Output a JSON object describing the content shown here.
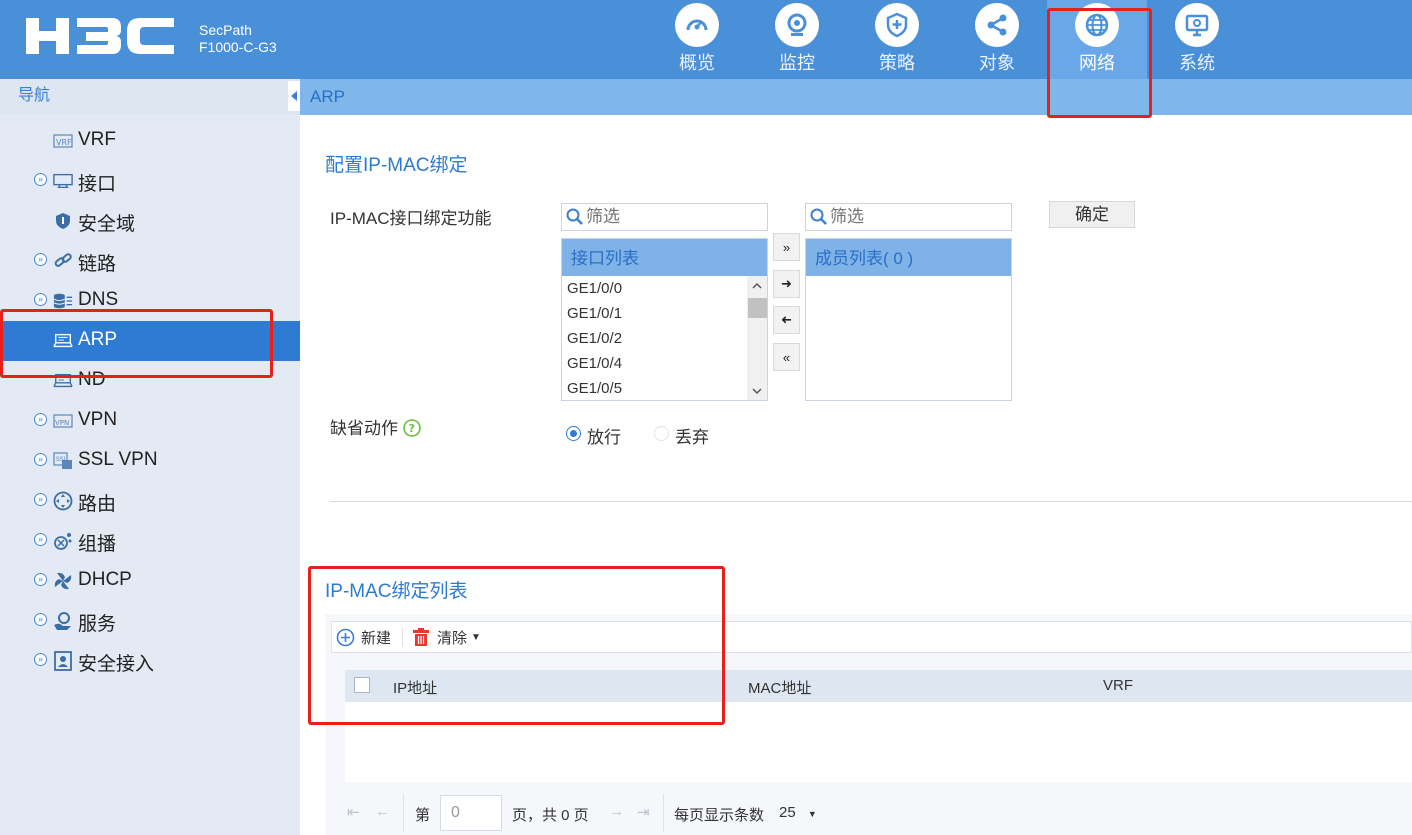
{
  "header": {
    "brand": "H3C",
    "model_line1": "SecPath",
    "model_line2": "F1000-C-G3",
    "nav": [
      {
        "label": "概览",
        "icon": "speedometer-icon"
      },
      {
        "label": "监控",
        "icon": "camera-icon"
      },
      {
        "label": "策略",
        "icon": "shield-icon"
      },
      {
        "label": "对象",
        "icon": "share-icon"
      },
      {
        "label": "网络",
        "icon": "globe-icon",
        "active": true
      },
      {
        "label": "系统",
        "icon": "monitor-icon"
      }
    ]
  },
  "sidebar": {
    "title": "导航",
    "items": [
      {
        "label": "VRF",
        "icon": "vrf-icon",
        "expandable": false
      },
      {
        "label": "接口",
        "icon": "interface-icon",
        "expandable": true
      },
      {
        "label": "安全域",
        "icon": "security-zone-icon",
        "expandable": false
      },
      {
        "label": "链路",
        "icon": "link-icon",
        "expandable": true
      },
      {
        "label": "DNS",
        "icon": "database-icon",
        "expandable": true
      },
      {
        "label": "ARP",
        "icon": "arp-icon",
        "expandable": false,
        "selected": true
      },
      {
        "label": "ND",
        "icon": "nd-icon",
        "expandable": false
      },
      {
        "label": "VPN",
        "icon": "vpn-icon",
        "expandable": true
      },
      {
        "label": "SSL VPN",
        "icon": "ssl-vpn-icon",
        "expandable": true
      },
      {
        "label": "路由",
        "icon": "routing-icon",
        "expandable": true
      },
      {
        "label": "组播",
        "icon": "multicast-icon",
        "expandable": true
      },
      {
        "label": "DHCP",
        "icon": "dhcp-icon",
        "expandable": true
      },
      {
        "label": "服务",
        "icon": "service-icon",
        "expandable": true
      },
      {
        "label": "安全接入",
        "icon": "secure-access-icon",
        "expandable": true
      }
    ]
  },
  "breadcrumb": "ARP",
  "binding_config": {
    "title": "配置IP-MAC绑定",
    "interface_label": "IP-MAC接口绑定功能",
    "filter_placeholder": "筛选",
    "available_header": "接口列表",
    "available": [
      "GE1/0/0",
      "GE1/0/1",
      "GE1/0/2",
      "GE1/0/4",
      "GE1/0/5"
    ],
    "members_header": "成员列表( 0 )",
    "ok_label": "确定",
    "default_action_label": "缺省动作",
    "radio_allow": "放行",
    "radio_drop": "丢弃",
    "selected_action": "放行"
  },
  "binding_list": {
    "title": "IP-MAC绑定列表",
    "new_label": "新建",
    "clear_label": "清除",
    "columns": [
      "IP地址",
      "MAC地址",
      "VRF"
    ],
    "pager": {
      "page_prefix": "第",
      "page_value": "0",
      "page_suffix": "页，共 0 页",
      "per_page_label": "每页显示条数",
      "per_page_value": "25"
    }
  },
  "colors": {
    "header_bg": "#4a90d9",
    "sidebar_bg": "#e3eaf4",
    "selected_bg": "#2f7bd4",
    "accent_text": "#2b7bd0",
    "highlight_box": "#e8201b"
  }
}
